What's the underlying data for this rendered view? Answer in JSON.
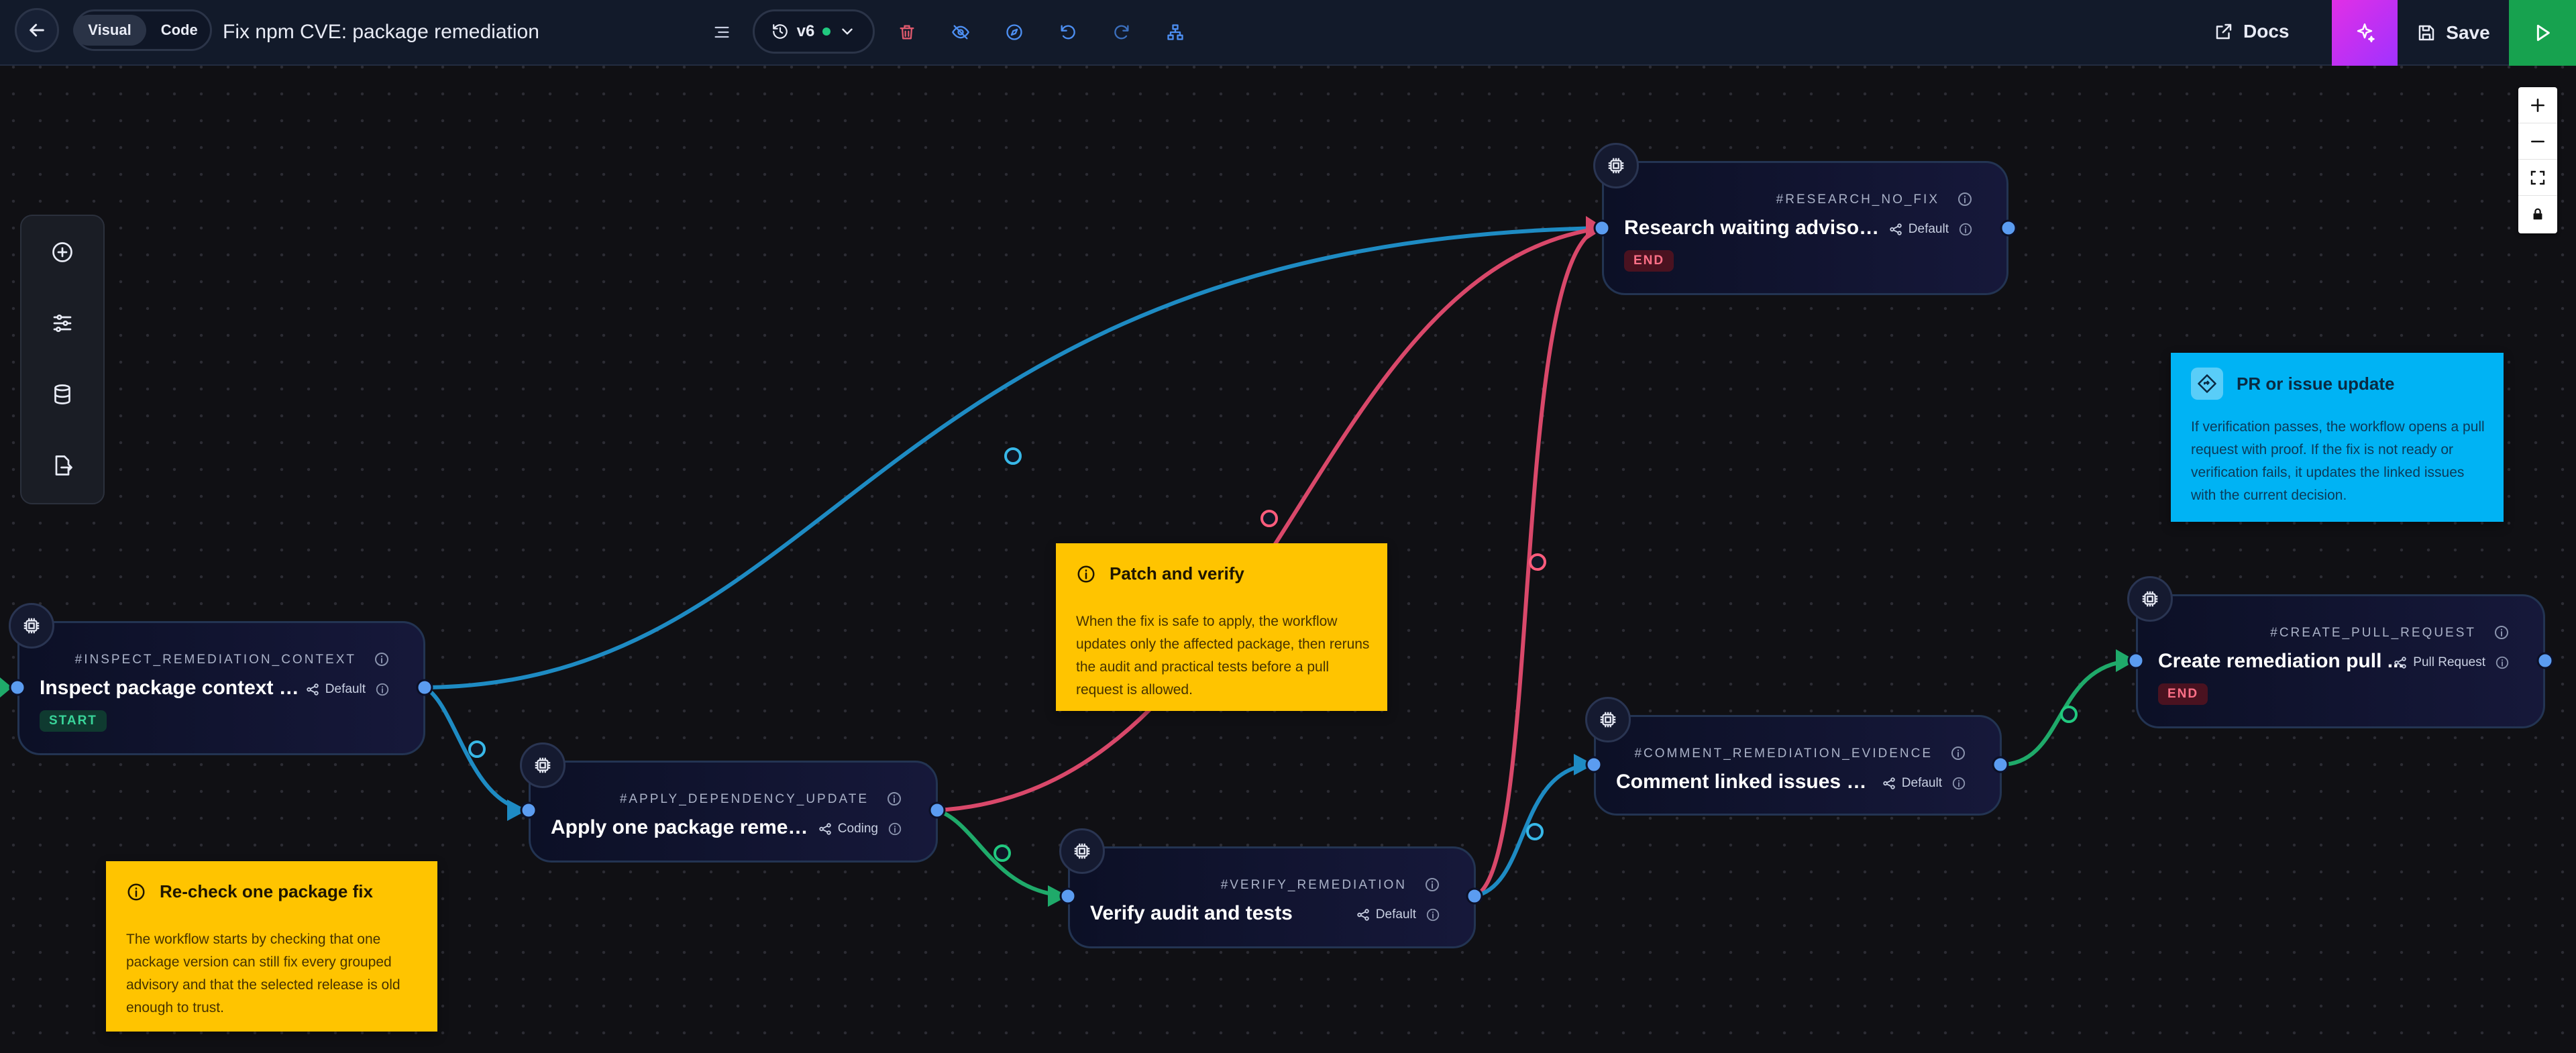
{
  "header": {
    "mode_toggle": {
      "visual_label": "Visual",
      "code_label": "Code"
    },
    "workflow_title": "Fix npm CVE: package remediation",
    "version_label": "v6",
    "docs_label": "Docs",
    "save_label": "Save"
  },
  "nodes": [
    {
      "id": "#INSPECT_REMEDIATION_CONTEXT",
      "title": "Inspect package context an...",
      "type": "Default",
      "badge": "START"
    },
    {
      "id": "#APPLY_DEPENDENCY_UPDATE",
      "title": "Apply one package remediat...",
      "type": "Coding"
    },
    {
      "id": "#VERIFY_REMEDIATION",
      "title": "Verify audit and tests",
      "type": "Default"
    },
    {
      "id": "#RESEARCH_NO_FIX",
      "title": "Research waiting advisory g...",
      "type": "Default",
      "badge": "END"
    },
    {
      "id": "#COMMENT_REMEDIATION_EVIDENCE",
      "title": "Comment linked issues with ...",
      "type": "Default"
    },
    {
      "id": "#CREATE_PULL_REQUEST",
      "title": "Create remediation pull ...",
      "type": "Pull Request",
      "badge": "END"
    }
  ],
  "notes": [
    {
      "title": "Patch and verify",
      "body": "When the fix is safe to apply, the workflow updates only the affected package, then reruns the audit and practical tests before a pull request is allowed."
    },
    {
      "title": "Re-check one package fix",
      "body": "The workflow starts by checking that one package version can still fix every grouped advisory and that the selected release is old enough to trust."
    },
    {
      "title": "PR or issue update",
      "body": "If verification passes, the workflow opens a pull request with proof. If the fix is not ready or verification fails, it updates the linked issues with the current decision."
    }
  ],
  "colors": {
    "edge_default": "#1e8bc3",
    "edge_failure": "#d9486a",
    "edge_success": "#1faa6a",
    "note_yellow": "#ffc400",
    "note_blue": "#00b3f4",
    "run_button": "#17a24f",
    "ai_button": "#c42ff0"
  },
  "icons": {
    "back": "arrow-left-icon",
    "menu": "list-icon",
    "history": "history-icon",
    "toolbar": [
      "trash-icon",
      "eye-off-icon",
      "compass-icon",
      "undo-icon",
      "redo-icon",
      "sitemap-icon"
    ],
    "docs": "external-link-icon",
    "ai": "sparkles-icon",
    "save": "floppy-disk-icon",
    "run": "play-icon",
    "zoom": [
      "plus-icon",
      "minus-icon",
      "fit-view-icon",
      "lock-icon"
    ],
    "sidebar": [
      "add-circle-icon",
      "sliders-icon",
      "database-icon",
      "file-export-icon"
    ],
    "node": "cpu-chip-icon"
  }
}
